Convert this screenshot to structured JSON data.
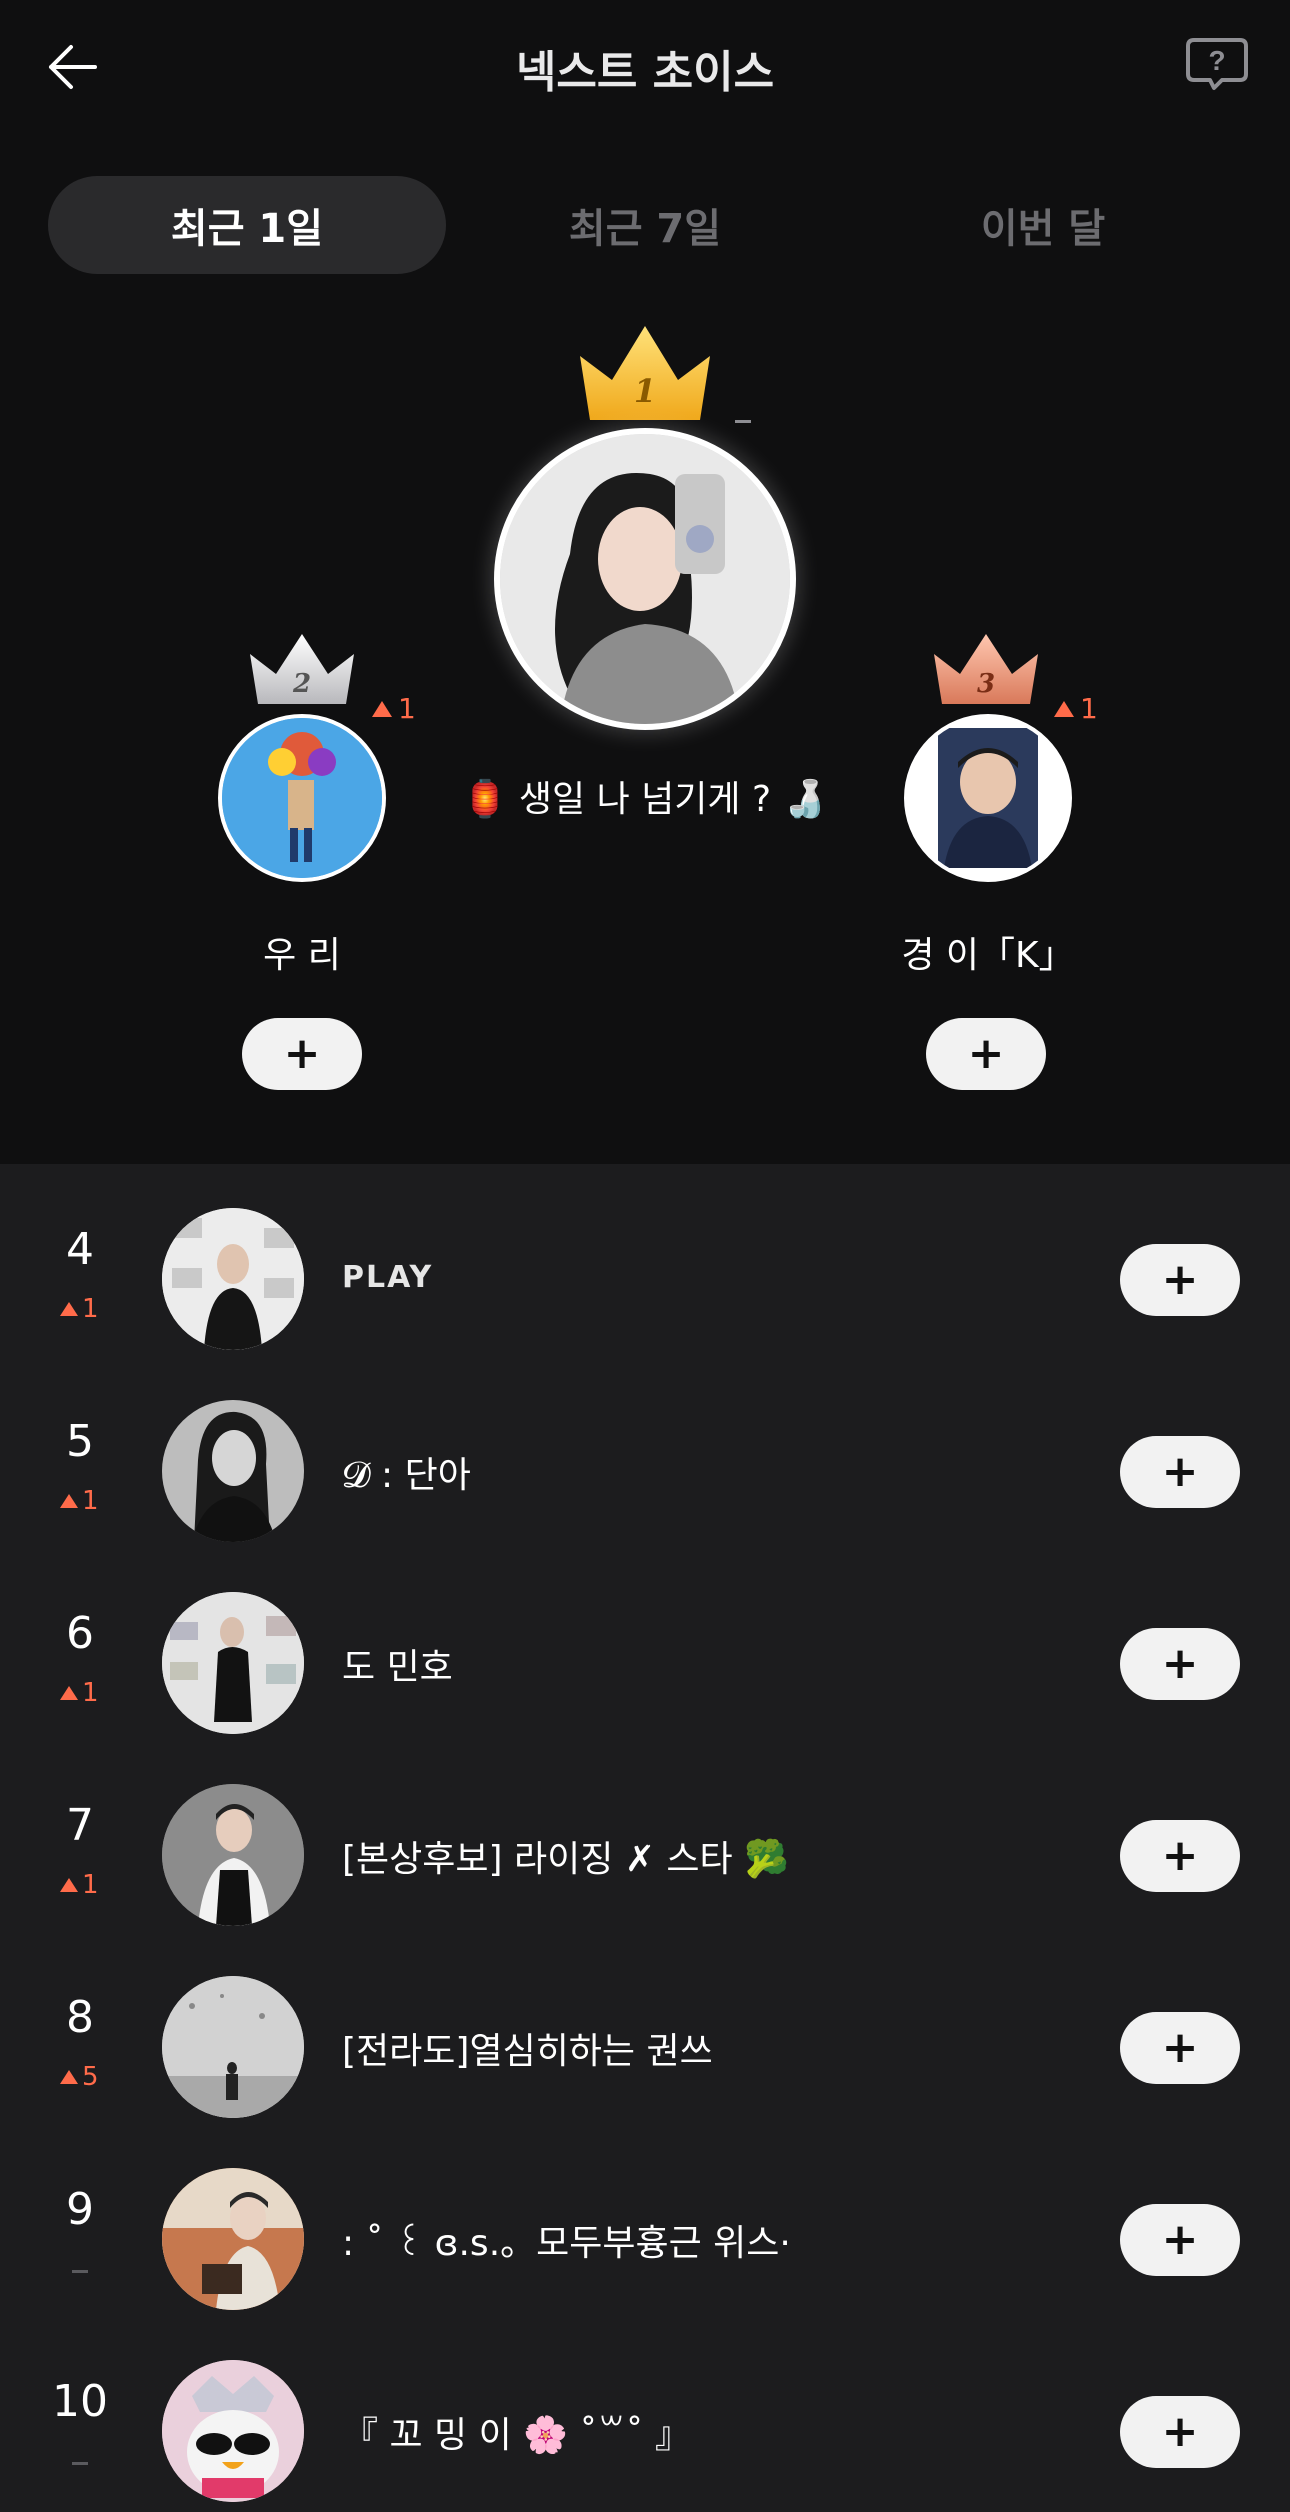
{
  "header": {
    "title": "넥스트 초이스"
  },
  "tabs": [
    {
      "label": "최근 1일",
      "active": true
    },
    {
      "label": "최근 7일",
      "active": false
    },
    {
      "label": "이번 달",
      "active": false
    }
  ],
  "podium": {
    "first": {
      "rank": "1",
      "name": "🏮 생일 나 넘기게 ? 🍶",
      "change": ""
    },
    "second": {
      "rank": "2",
      "name": "우 리",
      "change": "1"
    },
    "third": {
      "rank": "3",
      "name": "경 이「K」",
      "change": "1"
    },
    "add_label": "+"
  },
  "list": [
    {
      "rank": "4",
      "change": "1",
      "name": "PLAY",
      "add_label": "+"
    },
    {
      "rank": "5",
      "change": "1",
      "name": "𝓓 : 단아",
      "add_label": "+"
    },
    {
      "rank": "6",
      "change": "1",
      "name": "도 민호",
      "add_label": "+"
    },
    {
      "rank": "7",
      "change": "1",
      "name": "[본상후보] 라이징 ✗ 스타 🥦",
      "add_label": "+"
    },
    {
      "rank": "8",
      "change": "5",
      "name": "[전라도]열심히하는 권쓰",
      "add_label": "+"
    },
    {
      "rank": "9",
      "change": "",
      "name": ": ˚ ꒰ ɞ.s.。모두부흉근 위스·",
      "add_label": "+"
    },
    {
      "rank": "10",
      "change": "",
      "name": "『 꼬 밍 이 🌸 ˚꒳˚ 』",
      "add_label": "+"
    }
  ],
  "colors": {
    "background": "#0f0f10",
    "list_background": "#1c1c1e",
    "up_arrow": "#ff6b4a",
    "gold_crown": "#f5c542",
    "silver_crown": "#d7d7d9",
    "bronze_crown": "#e8967a"
  }
}
